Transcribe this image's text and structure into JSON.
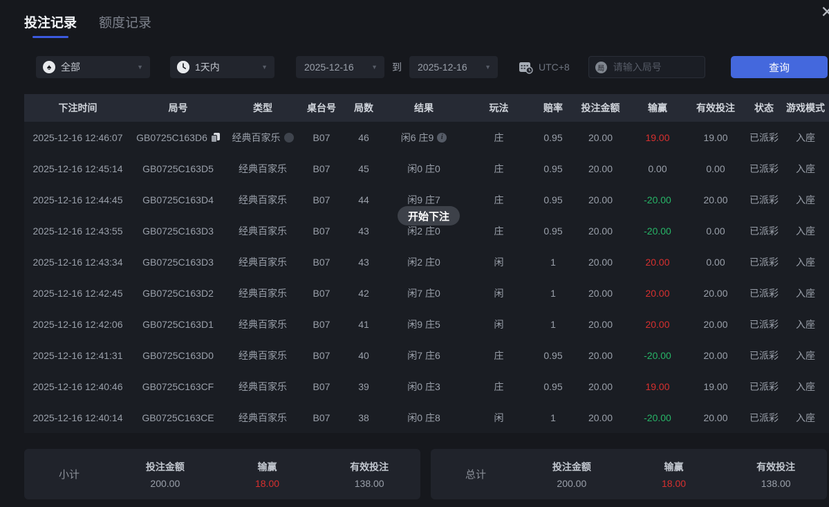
{
  "header": {
    "tabs": [
      {
        "label": "投注记录",
        "active": true
      },
      {
        "label": "额度记录",
        "active": false
      }
    ],
    "close_glyph": "✕"
  },
  "filters": {
    "spade_char": "♠",
    "game_type_value": "全部",
    "time_range_value": "1天内",
    "date_from": "2025-12-16",
    "to_label": "到",
    "date_to": "2025-12-16",
    "timezone": "UTC+8",
    "round_icon_char": "局",
    "round_placeholder": "请输入局号",
    "search_label": "查询",
    "caret_glyph": "▼"
  },
  "toast": {
    "label": "开始下注"
  },
  "table": {
    "headers": [
      "下注时间",
      "局号",
      "类型",
      "桌台号",
      "局数",
      "结果",
      "玩法",
      "赔率",
      "投注金额",
      "输赢",
      "有效投注",
      "状态",
      "游戏模式"
    ],
    "rows": [
      {
        "time": "2025-12-16 12:46:07",
        "round_id": "GB0725C163D6",
        "type": "经典百家乐",
        "table_no": "B07",
        "round_no": "46",
        "result": "闲6 庄9",
        "play": "庄",
        "odds": "0.95",
        "bet_amount": "20.00",
        "win_loss": "19.00",
        "win_loss_color": "red",
        "valid_bet": "19.00",
        "status": "已派彩",
        "mode": "入座",
        "show_copy": true,
        "show_type_help": true,
        "show_info": true
      },
      {
        "time": "2025-12-16 12:45:14",
        "round_id": "GB0725C163D5",
        "type": "经典百家乐",
        "table_no": "B07",
        "round_no": "45",
        "result": "闲0 庄0",
        "play": "庄",
        "odds": "0.95",
        "bet_amount": "20.00",
        "win_loss": "0.00",
        "win_loss_color": "gray",
        "valid_bet": "0.00",
        "status": "已派彩",
        "mode": "入座",
        "show_copy": false,
        "show_type_help": false,
        "show_info": false
      },
      {
        "time": "2025-12-16 12:44:45",
        "round_id": "GB0725C163D4",
        "type": "经典百家乐",
        "table_no": "B07",
        "round_no": "44",
        "result": "闲9 庄7",
        "play": "庄",
        "odds": "0.95",
        "bet_amount": "20.00",
        "win_loss": "-20.00",
        "win_loss_color": "green",
        "valid_bet": "20.00",
        "status": "已派彩",
        "mode": "入座",
        "show_copy": false,
        "show_type_help": false,
        "show_info": false
      },
      {
        "time": "2025-12-16 12:43:55",
        "round_id": "GB0725C163D3",
        "type": "经典百家乐",
        "table_no": "B07",
        "round_no": "43",
        "result": "闲2 庄0",
        "play": "庄",
        "odds": "0.95",
        "bet_amount": "20.00",
        "win_loss": "-20.00",
        "win_loss_color": "green",
        "valid_bet": "0.00",
        "status": "已派彩",
        "mode": "入座",
        "show_copy": false,
        "show_type_help": false,
        "show_info": false
      },
      {
        "time": "2025-12-16 12:43:34",
        "round_id": "GB0725C163D3",
        "type": "经典百家乐",
        "table_no": "B07",
        "round_no": "43",
        "result": "闲2 庄0",
        "play": "闲",
        "odds": "1",
        "bet_amount": "20.00",
        "win_loss": "20.00",
        "win_loss_color": "red",
        "valid_bet": "0.00",
        "status": "已派彩",
        "mode": "入座",
        "show_copy": false,
        "show_type_help": false,
        "show_info": false
      },
      {
        "time": "2025-12-16 12:42:45",
        "round_id": "GB0725C163D2",
        "type": "经典百家乐",
        "table_no": "B07",
        "round_no": "42",
        "result": "闲7 庄0",
        "play": "闲",
        "odds": "1",
        "bet_amount": "20.00",
        "win_loss": "20.00",
        "win_loss_color": "red",
        "valid_bet": "20.00",
        "status": "已派彩",
        "mode": "入座",
        "show_copy": false,
        "show_type_help": false,
        "show_info": false
      },
      {
        "time": "2025-12-16 12:42:06",
        "round_id": "GB0725C163D1",
        "type": "经典百家乐",
        "table_no": "B07",
        "round_no": "41",
        "result": "闲9 庄5",
        "play": "闲",
        "odds": "1",
        "bet_amount": "20.00",
        "win_loss": "20.00",
        "win_loss_color": "red",
        "valid_bet": "20.00",
        "status": "已派彩",
        "mode": "入座",
        "show_copy": false,
        "show_type_help": false,
        "show_info": false
      },
      {
        "time": "2025-12-16 12:41:31",
        "round_id": "GB0725C163D0",
        "type": "经典百家乐",
        "table_no": "B07",
        "round_no": "40",
        "result": "闲7 庄6",
        "play": "庄",
        "odds": "0.95",
        "bet_amount": "20.00",
        "win_loss": "-20.00",
        "win_loss_color": "green",
        "valid_bet": "20.00",
        "status": "已派彩",
        "mode": "入座",
        "show_copy": false,
        "show_type_help": false,
        "show_info": false
      },
      {
        "time": "2025-12-16 12:40:46",
        "round_id": "GB0725C163CF",
        "type": "经典百家乐",
        "table_no": "B07",
        "round_no": "39",
        "result": "闲0 庄3",
        "play": "庄",
        "odds": "0.95",
        "bet_amount": "20.00",
        "win_loss": "19.00",
        "win_loss_color": "red",
        "valid_bet": "19.00",
        "status": "已派彩",
        "mode": "入座",
        "show_copy": false,
        "show_type_help": false,
        "show_info": false
      },
      {
        "time": "2025-12-16 12:40:14",
        "round_id": "GB0725C163CE",
        "type": "经典百家乐",
        "table_no": "B07",
        "round_no": "38",
        "result": "闲0 庄8",
        "play": "闲",
        "odds": "1",
        "bet_amount": "20.00",
        "win_loss": "-20.00",
        "win_loss_color": "green",
        "valid_bet": "20.00",
        "status": "已派彩",
        "mode": "入座",
        "show_copy": false,
        "show_type_help": false,
        "show_info": false
      }
    ]
  },
  "summary": {
    "subtotal": {
      "title": "小计",
      "bet_label": "投注金额",
      "bet_value": "200.00",
      "winloss_label": "输赢",
      "winloss_value": "18.00",
      "valid_label": "有效投注",
      "valid_value": "138.00"
    },
    "total": {
      "title": "总计",
      "bet_label": "投注金额",
      "bet_value": "200.00",
      "winloss_label": "输赢",
      "winloss_value": "18.00",
      "valid_label": "有效投注",
      "valid_value": "138.00"
    }
  },
  "colors": {
    "accent_blue": "#4468dd",
    "win_red": "#d8302f",
    "loss_green": "#27b567"
  }
}
